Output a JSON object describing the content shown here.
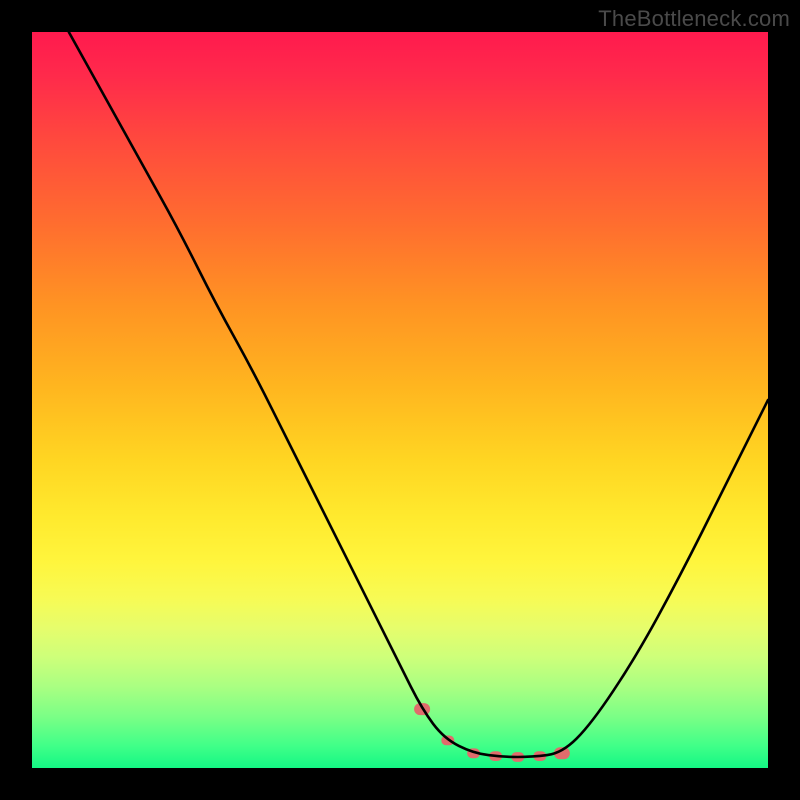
{
  "watermark": "TheBottleneck.com",
  "colors": {
    "background": "#000000",
    "watermark": "#4a4a4a",
    "curve_stroke": "#000000",
    "bumps_fill": "#e06c6c",
    "gradient_stops": [
      [
        "0%",
        "#ff1a4e"
      ],
      [
        "15%",
        "#ff4a3d"
      ],
      [
        "37%",
        "#ff9323"
      ],
      [
        "58%",
        "#ffd522"
      ],
      [
        "72%",
        "#fff53d"
      ],
      [
        "85%",
        "#cdff7a"
      ],
      [
        "100%",
        "#14f784"
      ]
    ]
  },
  "chart_data": {
    "type": "line",
    "title": "",
    "xlabel": "",
    "ylabel": "",
    "xlim": [
      0,
      100
    ],
    "ylim": [
      0,
      100
    ],
    "note": "Axes are unlabeled in the source; x and y are normalized 0–100 positions within the plot area. y=100 is top, y=0 is bottom.",
    "series": [
      {
        "name": "curve",
        "x": [
          5,
          10,
          15,
          20,
          25,
          30,
          35,
          40,
          45,
          50,
          53,
          56,
          60,
          64,
          68,
          72,
          76,
          82,
          88,
          94,
          100
        ],
        "y": [
          100,
          91,
          82,
          73,
          63,
          54,
          44,
          34,
          24,
          14,
          8,
          4,
          2,
          1.5,
          1.5,
          2,
          6,
          15,
          26,
          38,
          50
        ]
      }
    ],
    "bumps": {
      "note": "Pink rounded markers along the trough of the curve",
      "points_x": [
        53,
        56.5,
        60,
        63,
        66,
        69,
        72
      ]
    }
  }
}
